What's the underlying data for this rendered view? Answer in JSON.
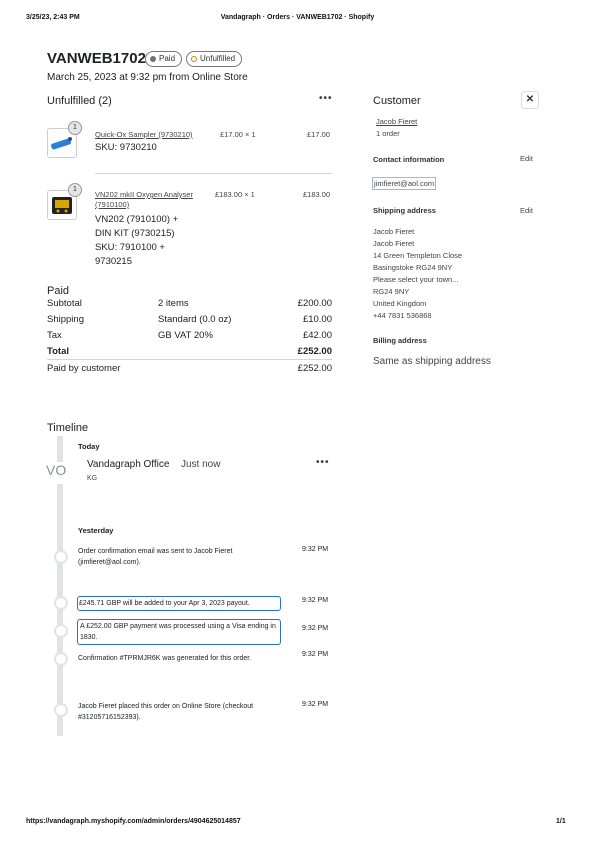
{
  "print_header": {
    "date": "3/25/23, 2:43 PM",
    "title": "Vandagraph · Orders · VANWEB1702 · Shopify"
  },
  "print_footer": {
    "url": "https://vandagraph.myshopify.com/admin/orders/4904625014857",
    "page": "1/1"
  },
  "order": {
    "name": "VANWEB1702",
    "badges": [
      "Paid",
      "Unfulfilled"
    ],
    "subtitle": "March 25, 2023 at 9:32 pm from Online Store"
  },
  "unfulfilled": {
    "title": "Unfulfilled (2)",
    "menu": "•••",
    "items": [
      {
        "qty_badge": "1",
        "name": "Quick-Ox Sampler (9730210)",
        "price_qty": "£17.00 × 1",
        "total": "£17.00",
        "sku_lines": [
          "SKU: 9730210"
        ]
      },
      {
        "qty_badge": "1",
        "name": "VN202 mkII Oxygen Analyser (7910100)",
        "price_qty": "£183.00 × 1",
        "total": "£183.00",
        "sku_lines": [
          "VN202 (7910100) +",
          "DIN KIT (9730215)",
          "SKU: 7910100 +",
          "9730215"
        ]
      }
    ]
  },
  "payment": {
    "title": "Paid",
    "rows": [
      {
        "label": "Subtotal",
        "mid": "2 items",
        "amount": "£200.00"
      },
      {
        "label": "Shipping",
        "mid": "Standard (0.0 oz)",
        "amount": "£10.00"
      },
      {
        "label": "Tax",
        "mid": "GB VAT 20%",
        "amount": "£42.00"
      }
    ],
    "total_label": "Total",
    "total_amount": "£252.00",
    "paid_label": "Paid by customer",
    "paid_amount": "£252.00"
  },
  "customer": {
    "title": "Customer",
    "close": "✕",
    "name": "Jacob Fieret",
    "orders": "1 order",
    "contact_label": "Contact information",
    "edit": "Edit",
    "email": "jimfieret@aol.com",
    "shipping_label": "Shipping address",
    "address": [
      "Jacob Fieret",
      "Jacob Fieret",
      "14 Green Templeton Close",
      "Basingstoke RG24 9NY",
      "Please select your town...",
      "RG24 9NY",
      "United Kingdom",
      "+44 7831 536868"
    ],
    "billing_label": "Billing address",
    "billing_value": "Same as shipping address"
  },
  "timeline": {
    "title": "Timeline",
    "today": "Today",
    "avatar": "VO",
    "comment_author": "Vandagraph Office",
    "comment_time": "Just now",
    "comment_text": "KG",
    "menu": "•••",
    "yesterday": "Yesterday",
    "events": [
      {
        "text": "Order confirmation email was sent to Jacob Fieret (jimfieret@aol.com).",
        "time": "9:32 PM"
      },
      {
        "text": "£245.71 GBP will be added to your Apr 3, 2023 payout.",
        "time": "9:32 PM"
      },
      {
        "text": "A £252.00 GBP payment was processed using a Visa ending in 1830.",
        "time": "9:32 PM"
      },
      {
        "text": "Confirmation #TPRMJR6K was generated for this order.",
        "time": "9:32 PM"
      },
      {
        "text": "Jacob Fieret placed this order on Online Store (checkout #31205716152393).",
        "time": "9:32 PM"
      }
    ]
  },
  "colors": {
    "unfulfilled_badge_dot": "#b98900",
    "link_box_border": "#2c6ecb",
    "product1_thumb": "#2b7fd6",
    "product2_thumb": "#d8a400"
  },
  "icons": [
    "quick-ox-product-icon",
    "oxygen-analyser-product-icon",
    "close-icon",
    "more-actions-icon"
  ]
}
